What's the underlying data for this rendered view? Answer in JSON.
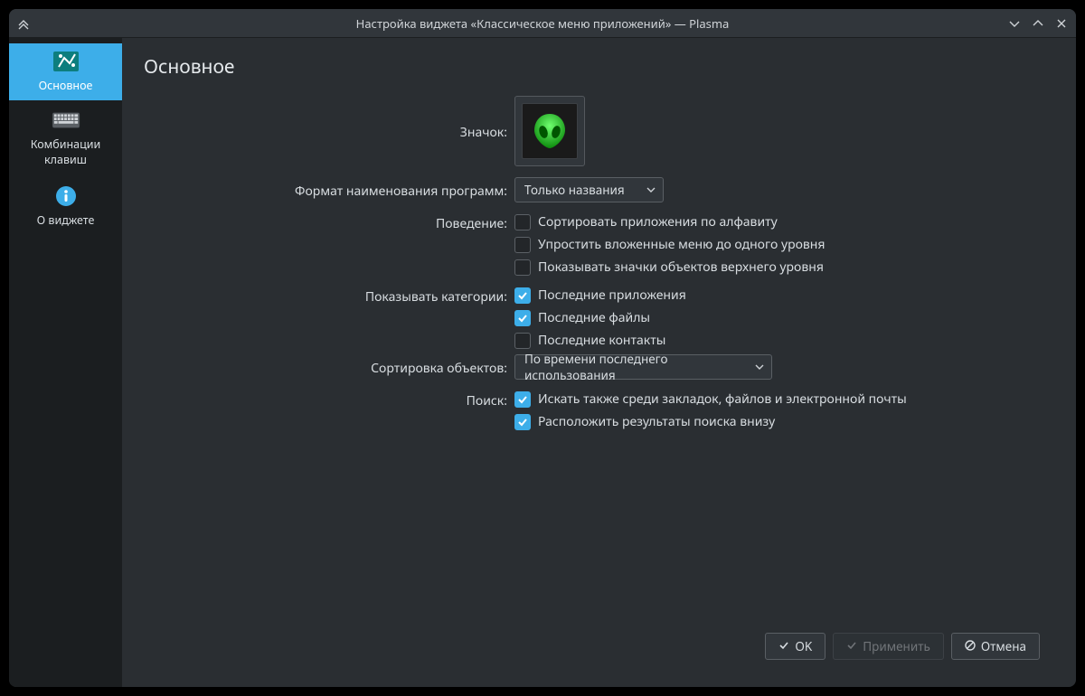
{
  "window": {
    "title": "Настройка виджета «Классическое меню приложений» — Plasma"
  },
  "sidebar": {
    "items": [
      {
        "label": "Основное",
        "icon": "appearance-icon",
        "active": true
      },
      {
        "label": "Комбинации клавиш",
        "icon": "keyboard-icon",
        "active": false
      },
      {
        "label": "О виджете",
        "icon": "info-icon",
        "active": false
      }
    ]
  },
  "page": {
    "title": "Основное",
    "icon_label": "Значок:",
    "format": {
      "label": "Формат наименования программ:",
      "value": "Только названия"
    },
    "behavior": {
      "label": "Поведение:",
      "items": [
        {
          "text": "Сортировать приложения по алфавиту",
          "checked": false
        },
        {
          "text": "Упростить вложенные меню до одного уровня",
          "checked": false
        },
        {
          "text": "Показывать значки объектов верхнего уровня",
          "checked": false
        }
      ]
    },
    "categories": {
      "label": "Показывать категории:",
      "items": [
        {
          "text": "Последние приложения",
          "checked": true
        },
        {
          "text": "Последние файлы",
          "checked": true
        },
        {
          "text": "Последние контакты",
          "checked": false
        }
      ]
    },
    "sort": {
      "label": "Сортировка объектов:",
      "value": "По времени последнего использования"
    },
    "search": {
      "label": "Поиск:",
      "items": [
        {
          "text": "Искать также среди закладок, файлов и электронной почты",
          "checked": true
        },
        {
          "text": "Расположить результаты поиска внизу",
          "checked": true
        }
      ]
    }
  },
  "footer": {
    "ok": "OK",
    "apply": "Применить",
    "cancel": "Отмена"
  }
}
